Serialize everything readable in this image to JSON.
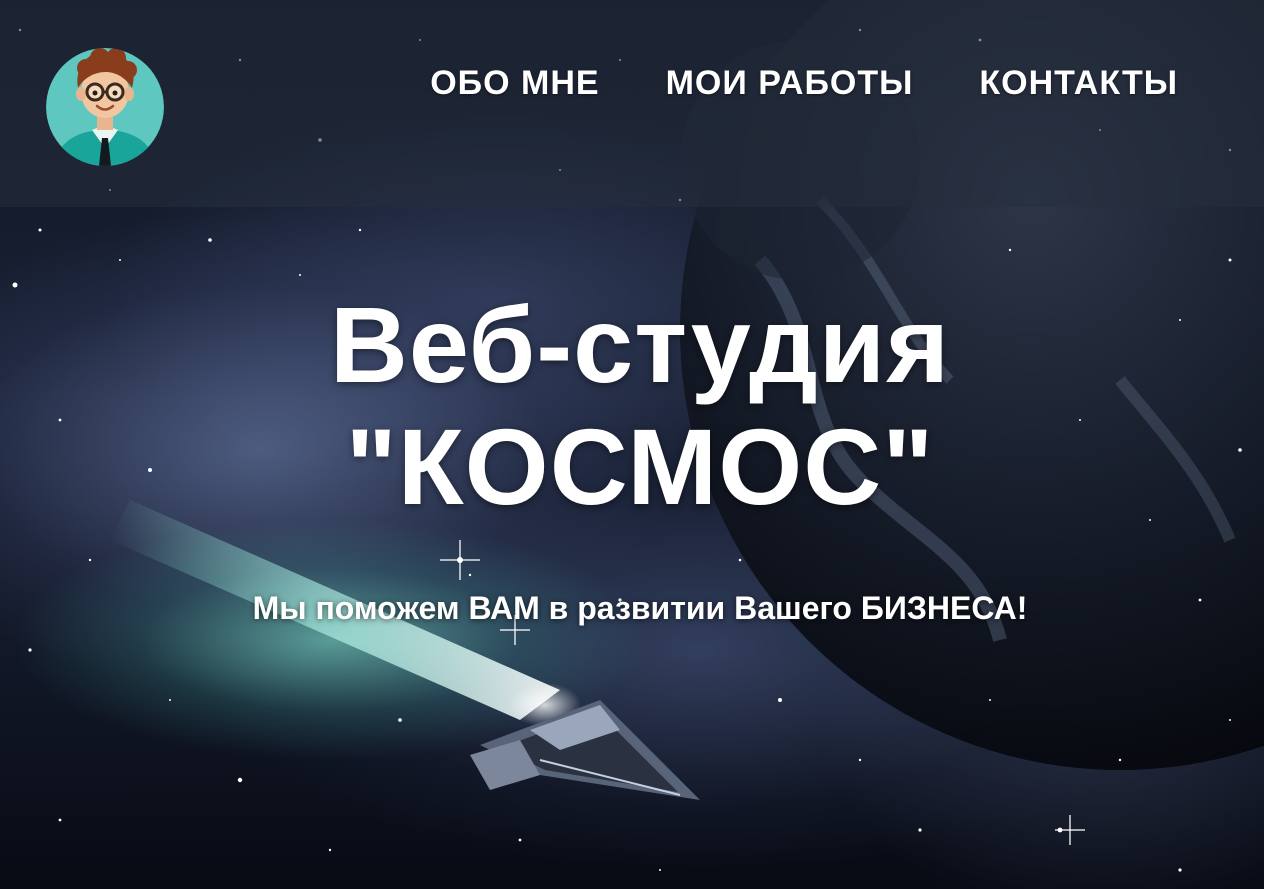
{
  "header": {
    "avatar_icon": "cartoon-developer-avatar-icon",
    "nav": [
      {
        "label": "ОБО МНЕ"
      },
      {
        "label": "МОИ РАБОТЫ"
      },
      {
        "label": "КОНТАКТЫ"
      }
    ]
  },
  "hero": {
    "title_line1": "Веб-студия",
    "title_line2": "\"КОСМОС\"",
    "subtitle": "Мы поможем ВАМ в развитии Вашего БИЗНЕСА!"
  },
  "colors": {
    "header_overlay": "#26303e",
    "avatar_bg": "#5ec8c0",
    "text": "#ffffff"
  }
}
